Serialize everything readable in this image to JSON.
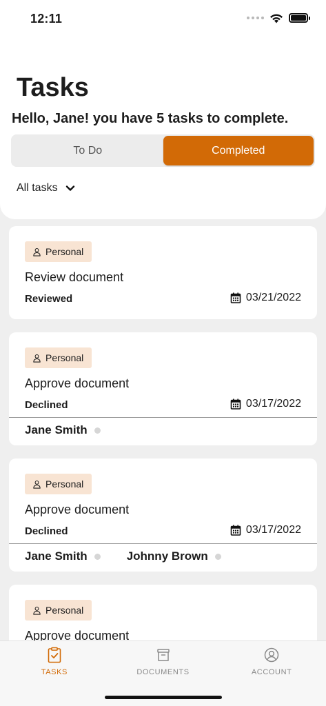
{
  "status_bar": {
    "time": "12:11"
  },
  "header": {
    "title": "Tasks",
    "greeting": "Hello, Jane! you have 5 tasks to complete.",
    "segments": [
      {
        "label": "To Do",
        "active": false
      },
      {
        "label": "Completed",
        "active": true
      }
    ],
    "filter_label": "All tasks"
  },
  "colors": {
    "accent": "#d26a06",
    "badge_bg": "#f8e4d3",
    "page_bg": "#efefef"
  },
  "tasks": [
    {
      "tag": "Personal",
      "tag_icon": "person-icon",
      "title": "Review document",
      "status": "Reviewed",
      "date": "03/21/2022",
      "assignees": []
    },
    {
      "tag": "Personal",
      "tag_icon": "person-icon",
      "title": "Approve document",
      "status": "Declined",
      "date": "03/17/2022",
      "assignees": [
        "Jane Smith"
      ]
    },
    {
      "tag": "Personal",
      "tag_icon": "person-icon",
      "title": "Approve document",
      "status": "Declined",
      "date": "03/17/2022",
      "assignees": [
        "Jane Smith",
        "Johnny Brown"
      ]
    },
    {
      "tag": "Personal",
      "tag_icon": "person-icon",
      "title": "Approve document",
      "status": "",
      "date": "",
      "assignees": []
    }
  ],
  "tab_bar": {
    "items": [
      {
        "label": "TASKS",
        "icon": "clipboard-check-icon",
        "active": true
      },
      {
        "label": "DOCUMENTS",
        "icon": "archive-box-icon",
        "active": false
      },
      {
        "label": "ACCOUNT",
        "icon": "user-circle-icon",
        "active": false
      }
    ]
  }
}
